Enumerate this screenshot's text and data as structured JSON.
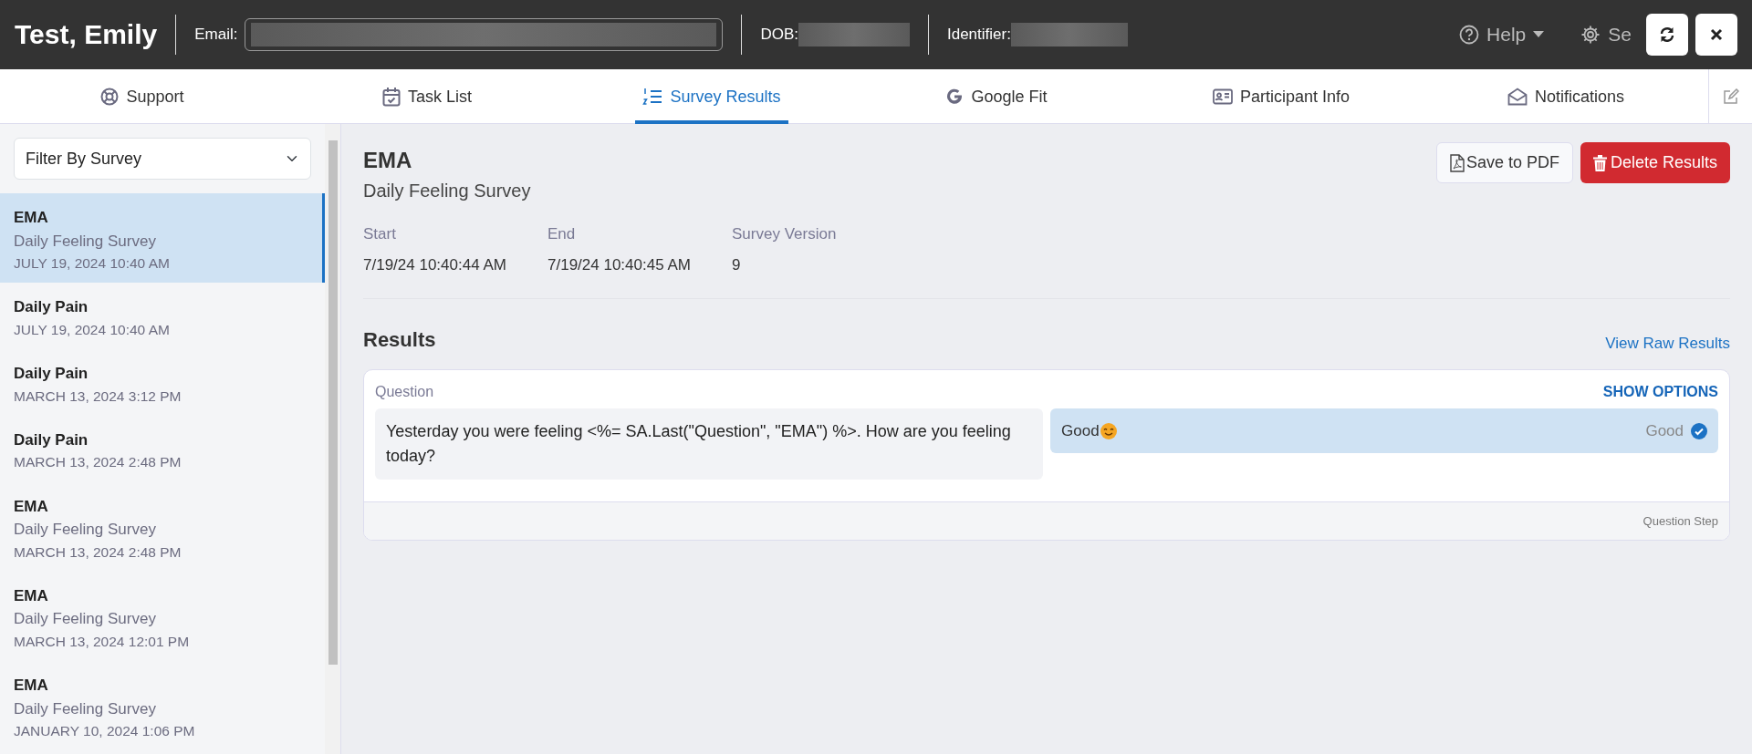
{
  "header": {
    "name": "Test, Emily",
    "fields": [
      {
        "label": "Email:",
        "kind": "input"
      },
      {
        "label": "DOB:",
        "kind": "plain"
      },
      {
        "label": "Identifier:",
        "kind": "plain"
      }
    ],
    "background_menu": [
      {
        "label": "Help",
        "kind": "dropdown"
      },
      {
        "label": "Se",
        "kind": "gear"
      }
    ],
    "buttons": [
      {
        "kind": "refresh"
      },
      {
        "kind": "close"
      }
    ]
  },
  "tabs": [
    {
      "label": "Support",
      "kind": "lifebuoy",
      "selected": false
    },
    {
      "label": "Task List",
      "kind": "calendar",
      "selected": false
    },
    {
      "label": "Survey Results",
      "kind": "numbered-list",
      "selected": true
    },
    {
      "label": "Google Fit",
      "kind": "google",
      "selected": false
    },
    {
      "label": "Participant Info",
      "kind": "id-card",
      "selected": false
    },
    {
      "label": "Notifications",
      "kind": "envelope",
      "selected": false
    }
  ],
  "sidebar": {
    "filter": {
      "value": "Filter By Survey"
    },
    "items": [
      {
        "title": "EMA",
        "subtitle": "Daily Feeling Survey",
        "date": "JULY 19, 2024 10:40 AM",
        "selected": true
      },
      {
        "title": "Daily Pain",
        "date": "JULY 19, 2024 10:40 AM",
        "selected": false
      },
      {
        "title": "Daily Pain",
        "date": "MARCH 13, 2024 3:12 PM",
        "selected": false
      },
      {
        "title": "Daily Pain",
        "date": "MARCH 13, 2024 2:48 PM",
        "selected": false
      },
      {
        "title": "EMA",
        "subtitle": "Daily Feeling Survey",
        "date": "MARCH 13, 2024 2:48 PM",
        "selected": false
      },
      {
        "title": "EMA",
        "subtitle": "Daily Feeling Survey",
        "date": "MARCH 13, 2024 12:01 PM",
        "selected": false
      },
      {
        "title": "EMA",
        "subtitle": "Daily Feeling Survey",
        "date": "JANUARY 10, 2024 1:06 PM",
        "selected": false
      }
    ]
  },
  "detail": {
    "title": "EMA",
    "subtitle": "Daily Feeling Survey",
    "buttons": [
      {
        "label": "Save to PDF",
        "kind": "pdf"
      },
      {
        "label": "Delete Results",
        "kind": "delete"
      }
    ],
    "meta": [
      {
        "label": "Start",
        "value": "7/19/24 10:40:44 AM"
      },
      {
        "label": "End",
        "value": "7/19/24 10:40:45 AM"
      },
      {
        "label": "Survey Version",
        "value": "9"
      }
    ],
    "results": {
      "heading": "Results",
      "link": "View Raw Results",
      "card": {
        "label": "Question",
        "toggle": "SHOW OPTIONS",
        "question": "Yesterday you were feeling <%= SA.Last(\"Question\", \"EMA\") %>. How are you feeling today?",
        "answer": {
          "text": "Good",
          "value": "Good",
          "selected": true
        },
        "footer": "Question Step"
      }
    }
  }
}
